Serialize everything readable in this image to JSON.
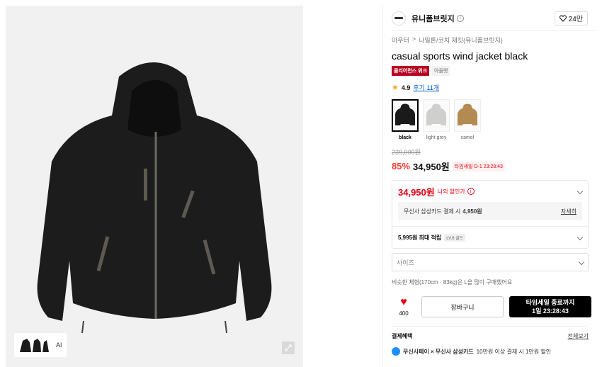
{
  "brand": {
    "name": "유니폼브릿지",
    "likes": "24만"
  },
  "breadcrumb": [
    "아우터",
    "나일론/코치 재킷(유니폼브릿지)"
  ],
  "breadcrumb_sep": ">",
  "product": {
    "title": "casual sports wind jacket black",
    "tags": [
      "클리어런스 위크",
      "아울렛"
    ],
    "rating": "4.9",
    "reviews": "후기 11개"
  },
  "colors": [
    {
      "label": "black",
      "hex": "#1a1a1a",
      "selected": true
    },
    {
      "label": "light grey",
      "hex": "#cfcfcd",
      "selected": false
    },
    {
      "label": "camel",
      "hex": "#b38a52",
      "selected": false
    }
  ],
  "price": {
    "original": "239,000원",
    "discount": "85%",
    "sale": "34,950원",
    "timesale_tag": "타임세일 D-1 23:28:43"
  },
  "benefits": {
    "my_price": "34,950원",
    "my_price_label": "나의 할인가",
    "card_text": "무신사 삼성카드 결제 시",
    "card_price": "4,950원",
    "details": "자세히",
    "points": "5,995원 최대 적립",
    "level": "LV.6 골드"
  },
  "size": {
    "placeholder": "사이즈"
  },
  "fit_note": "비슷한 체형(170cm · 83kg)은 L을 많이 구매했어요",
  "actions": {
    "wish_count": "400",
    "cart": "장바구니",
    "buy_line1": "타임세일 종료까지",
    "buy_line2": "1일 23:28:43"
  },
  "payment": {
    "title": "결제혜택",
    "view_all": "전체보기",
    "row": "무신사페이 × 무신사 삼성카드",
    "row_detail": "10만원 이상 결제 시 1만원 할인"
  },
  "gallery": {
    "ai_badge": "AI"
  },
  "icons": [
    "info-icon",
    "heart-icon",
    "star-icon",
    "chevron-down-icon",
    "expand-icon",
    "heart-filled-icon"
  ]
}
